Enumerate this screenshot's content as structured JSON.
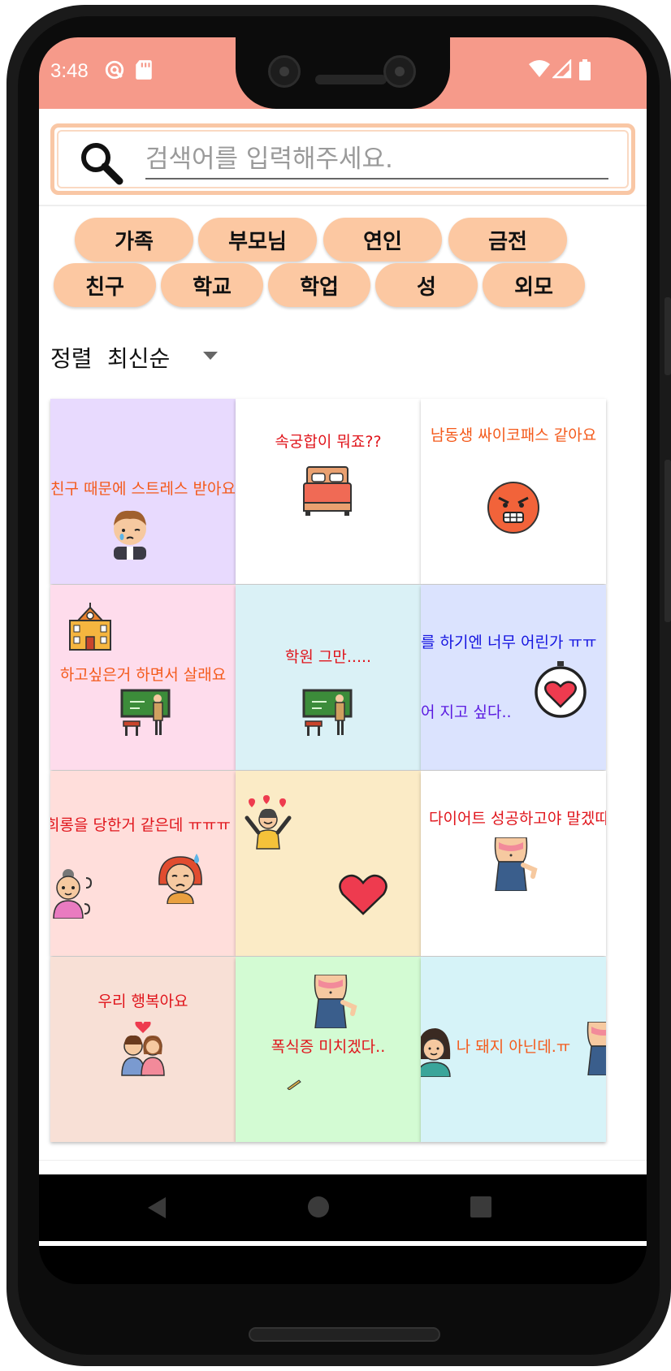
{
  "status_bar": {
    "time": "3:48"
  },
  "search": {
    "placeholder": "검색어를 입력해주세요.",
    "value": ""
  },
  "categories": [
    "가족",
    "부모님",
    "연인",
    "금전",
    "친구",
    "학교",
    "학업",
    "성",
    "외모"
  ],
  "sort": {
    "label": "정렬",
    "value": "최신순"
  },
  "posts": [
    {
      "text": "친구 때문에 스트레스 받아요",
      "bg": "#e8dafe",
      "color": "#f45a1b"
    },
    {
      "text": "속궁합이 뭐죠??",
      "bg": "#ffffff",
      "color": "#e0141b"
    },
    {
      "text": "남동생 싸이코패스 같아요",
      "bg": "#ffffff",
      "color": "#f45a1b"
    },
    {
      "text": "하고싶은거 하면서 살래요",
      "bg": "#fedcec",
      "color": "#f45a1b"
    },
    {
      "text": "학원 그만.....",
      "bg": "#daf1f6",
      "color": "#e0141b"
    },
    {
      "text": "를 하기엔 너무 어린가 ㅠㅠ",
      "text2": "어 지고 싶다..",
      "bg": "#dbe3fe",
      "color": "#1414e0",
      "color2": "#5a1ae0"
    },
    {
      "text": "희롱을 당한거 같은데 ㅠㅠㅠ",
      "bg": "#ffdedb",
      "color": "#e0141b"
    },
    {
      "text": "",
      "bg": "#fbebc6",
      "color": "#e0141b"
    },
    {
      "text": "다이어트 성공하고야 말겠따",
      "bg": "#ffffff",
      "color": "#e0141b"
    },
    {
      "text": "우리 행복아요",
      "bg": "#f8e0d6",
      "color": "#e0141b"
    },
    {
      "text": "폭식증 미치겠다..",
      "bg": "#d3fbd3",
      "color": "#e0141b"
    },
    {
      "text": "나 돼지 아닌데.ㅠ",
      "bg": "#d6f3f8",
      "color": "#f45a1b"
    }
  ],
  "nav": {
    "items": [
      "home-icon",
      "search-icon",
      "add-box-icon",
      "heart-icon",
      "person-icon"
    ],
    "active": "search-icon",
    "active_color": "#f28a7a",
    "inactive_color": "#757575"
  },
  "colors": {
    "status_bar": "#f69a8a",
    "chip": "#fcc8a2",
    "search_border": "#f9c7a5"
  }
}
